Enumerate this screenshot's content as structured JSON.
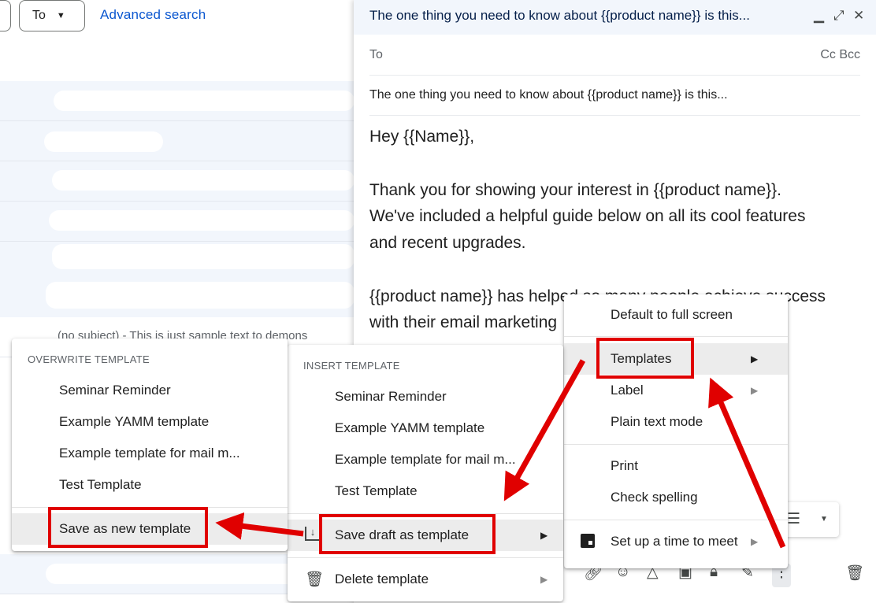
{
  "search_bar": {
    "to_label": "To",
    "advanced_search": "Advanced search"
  },
  "inbox": {
    "partial_row_text": "(no subject) - This is just sample text to demons"
  },
  "compose": {
    "title": "The one thing you need to know about {{product name}} is this...",
    "to_label": "To",
    "cc_bcc": "Cc Bcc",
    "subject": "The one thing you need to know about {{product name}} is this...",
    "body": {
      "greeting": "Hey {{Name}},",
      "para1_line1": "Thank you for showing your interest in {{product name}}.",
      "para1_line2": "We've included a helpful guide below on all its cool features",
      "para1_line3": "and recent upgrades.",
      "para2_line1": "{{product name}} has helped so many people achieve success",
      "para2_line2": "with their email marketing"
    }
  },
  "more_options_menu": {
    "items": [
      {
        "label": "Default to full screen"
      },
      {
        "label": "Templates"
      },
      {
        "label": "Label"
      },
      {
        "label": "Plain text mode"
      },
      {
        "label": "Print"
      },
      {
        "label": "Check spelling"
      },
      {
        "label": "Set up a time to meet"
      }
    ]
  },
  "templates_menu": {
    "section": "INSERT TEMPLATE",
    "items": [
      {
        "label": "Seminar Reminder"
      },
      {
        "label": "Example YAMM template"
      },
      {
        "label": "Example template for mail m..."
      },
      {
        "label": "Test Template"
      }
    ],
    "save_draft": "Save draft as template",
    "delete": "Delete template"
  },
  "save_menu": {
    "section": "OVERWRITE TEMPLATE",
    "items": [
      {
        "label": "Seminar Reminder"
      },
      {
        "label": "Example YAMM template"
      },
      {
        "label": "Example template for mail m..."
      },
      {
        "label": "Test Template"
      }
    ],
    "save_new": "Save as new template"
  },
  "colors": {
    "highlight_box": "#e00000",
    "link": "#0b57d0",
    "header_bg": "#f2f6fc"
  }
}
